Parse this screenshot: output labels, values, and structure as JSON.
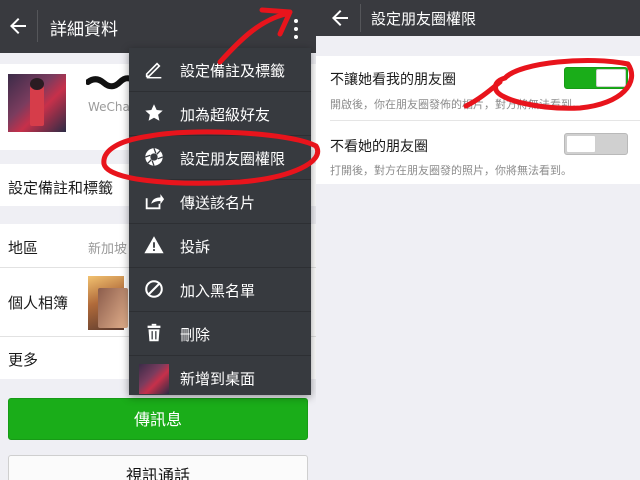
{
  "left": {
    "appbar": {
      "back_icon": "arrow-left-icon",
      "title": "詳細資料",
      "overflow_icon": "more-vertical-icon"
    },
    "profile": {
      "wechat_id_label": "WeChat"
    },
    "cells": [
      {
        "label": "設定備註和標籤",
        "value": ""
      },
      {
        "label": "地區",
        "value": "新加坡"
      },
      {
        "label": "個人相簿",
        "value": ""
      },
      {
        "label": "更多",
        "value": ""
      }
    ],
    "buttons": {
      "send": "傳訊息",
      "video": "視訊通話"
    }
  },
  "menu": {
    "items": [
      {
        "label": "設定備註及標籤",
        "icon": "pencil-icon"
      },
      {
        "label": "加為超級好友",
        "icon": "star-icon"
      },
      {
        "label": "設定朋友圈權限",
        "icon": "moments-shutter-icon"
      },
      {
        "label": "傳送該名片",
        "icon": "share-icon"
      },
      {
        "label": "投訴",
        "icon": "warning-icon"
      },
      {
        "label": "加入黑名單",
        "icon": "block-icon"
      },
      {
        "label": "刪除",
        "icon": "trash-icon"
      },
      {
        "label": "新增到桌面",
        "icon": "contact-avatar"
      }
    ]
  },
  "right": {
    "appbar": {
      "back_icon": "arrow-left-icon",
      "title": "設定朋友圈權限"
    },
    "settings": [
      {
        "title": "不讓她看我的朋友圈",
        "desc": "開啟後，你在朋友圈發佈的相片，對方將無法看到。",
        "enabled": true
      },
      {
        "title": "不看她的朋友圈",
        "desc": "打開後，對方在朋友圈發的照片，你將無法看到。",
        "enabled": false
      }
    ]
  },
  "colors": {
    "toolbar": "#393a3f",
    "menu": "#373a3f",
    "accent_green": "#1aad19",
    "background": "#efeff4",
    "annotation_red": "#e8141c"
  }
}
